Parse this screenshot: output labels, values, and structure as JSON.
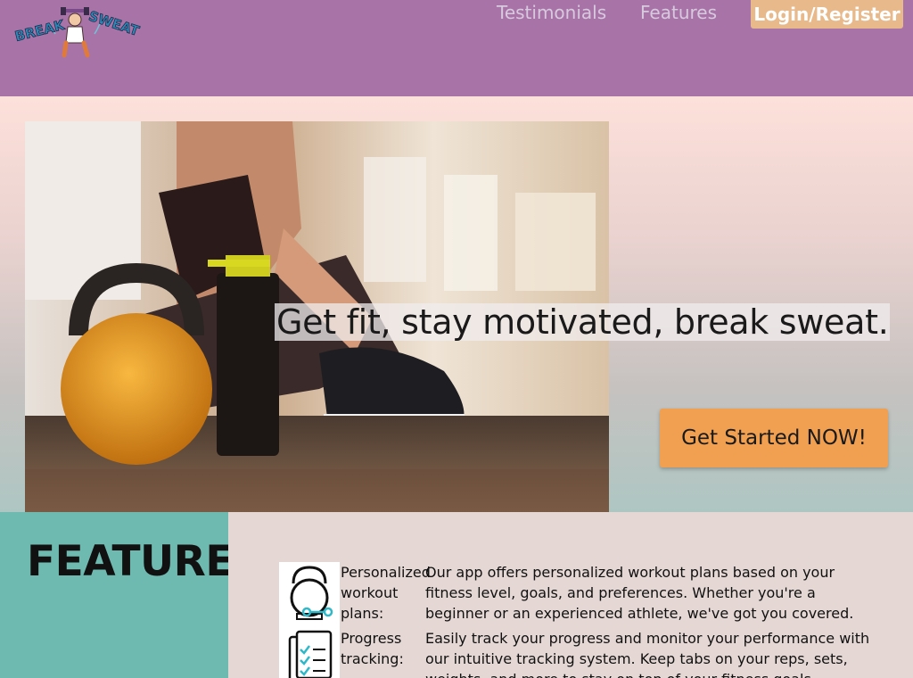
{
  "header": {
    "nav": {
      "testimonials": "Testimonials",
      "features": "Features"
    },
    "login_label": "Login/Register",
    "logo_text": "BREAK SWEAT"
  },
  "hero": {
    "tagline": "Get fit, stay motivated, break sweat.",
    "cta_label": "Get Started NOW!"
  },
  "features": {
    "title": "FEATURES",
    "items": [
      {
        "name": "Personalized workout plans:",
        "description": "Our app offers personalized workout plans based on your fitness level, goals, and preferences. Whether you're a beginner or an experienced athlete, we've got you covered.",
        "icon": "kettlebell-icon"
      },
      {
        "name": "Progress tracking:",
        "description": "Easily track your progress and monitor your performance with our intuitive tracking system. Keep tabs on your reps, sets, weights, and more to stay on top of your fitness goals.",
        "icon": "checklist-icon"
      }
    ]
  },
  "colors": {
    "header_bg": "#a874a8",
    "login_bg": "#e8b98a",
    "cta_bg": "#f0a050",
    "features_panel_bg": "#6fbab0",
    "features_bg": "#e5d8d4"
  }
}
